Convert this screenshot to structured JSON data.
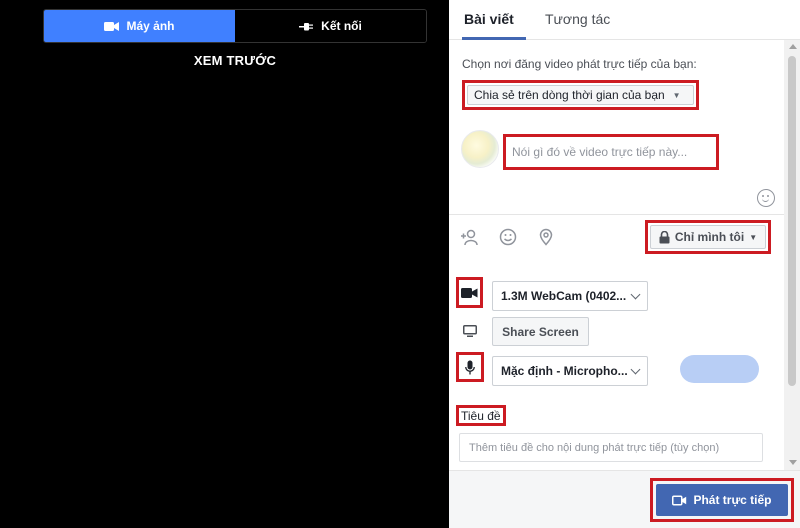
{
  "preview": {
    "tabs": [
      {
        "label": "Máy ảnh",
        "icon": "video-camera-icon",
        "active": true
      },
      {
        "label": "Kết nối",
        "icon": "connect-plug-icon",
        "active": false
      }
    ],
    "title": "XEM TRƯỚC"
  },
  "composer": {
    "tabs": [
      {
        "label": "Bài viết",
        "active": true
      },
      {
        "label": "Tương tác",
        "active": false
      }
    ],
    "prompt": "Chọn nơi đăng video phát trực tiếp của bạn:",
    "audience": "Chia sẻ trên dòng thời gian của bạn",
    "message_placeholder": "Nói gì đó về video trực tiếp này...",
    "privacy": "Chỉ mình tôi",
    "camera_device": "1.3M WebCam (0402...",
    "share_screen_label": "Share Screen",
    "microphone_device": "Mặc định - Micropho...",
    "title_label": "Tiêu đề",
    "title_placeholder": "Thêm tiêu đề cho nội dung phát trực tiếp (tùy chọn)",
    "go_live_label": "Phát trực tiếp"
  },
  "colors": {
    "accent": "#4080ff",
    "button_blue": "#4267b2",
    "highlight_red": "#cc1b22"
  }
}
